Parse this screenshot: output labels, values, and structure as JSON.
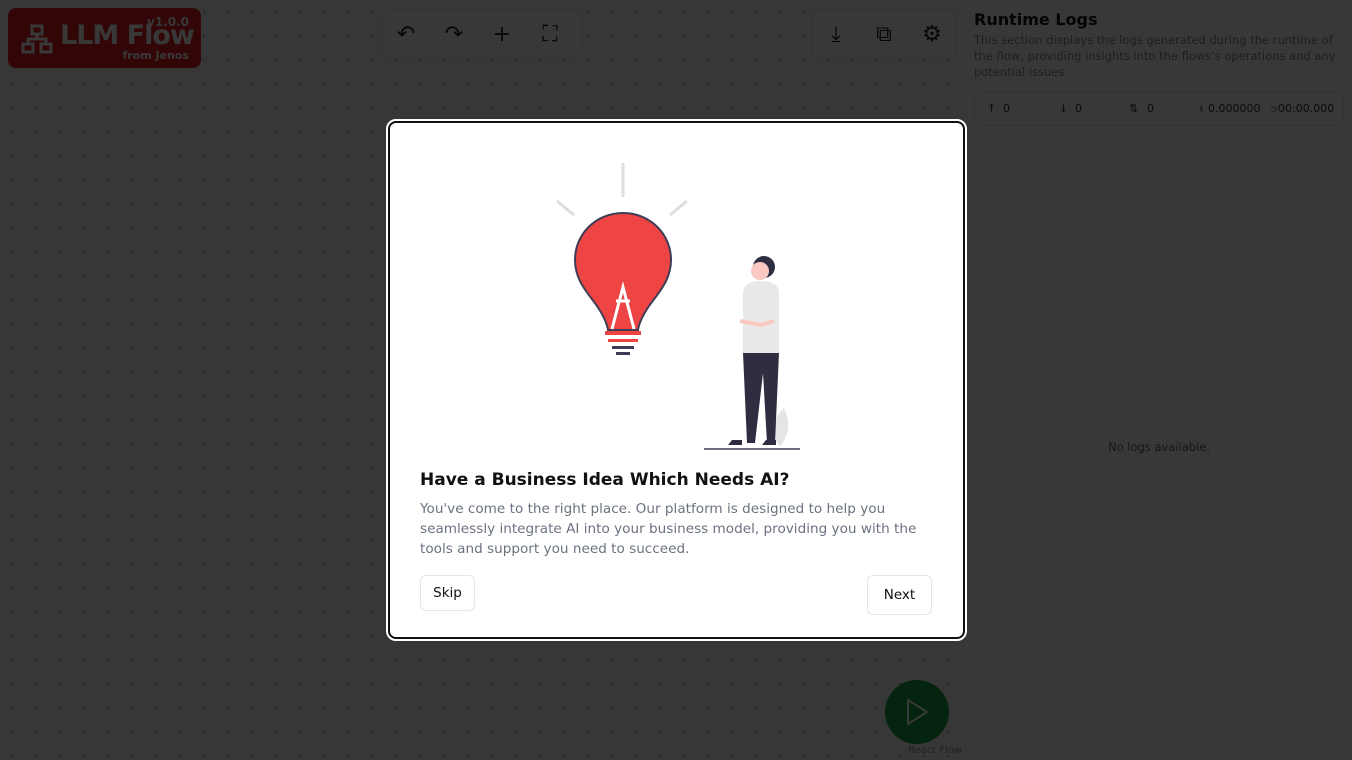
{
  "logo": {
    "title": "LLM Flow",
    "version": "v1.0.0",
    "subtitle": "from Jenos"
  },
  "toolbar": {
    "left": [
      {
        "icon": "undo-icon",
        "glyph": "↶"
      },
      {
        "icon": "redo-icon",
        "glyph": "↷"
      },
      {
        "icon": "plus-icon",
        "glyph": "+"
      },
      {
        "icon": "fullscreen-icon",
        "glyph": "⛶"
      }
    ],
    "right": [
      {
        "icon": "download-icon",
        "glyph": "⤓"
      },
      {
        "icon": "external-link-icon",
        "glyph": "⧉"
      },
      {
        "icon": "settings-icon",
        "glyph": "⚙"
      }
    ]
  },
  "logs": {
    "title": "Runtime Logs",
    "description": "This section displays the logs generated during the runtime of the flow, providing insights into the flows's operations and any potential issues.",
    "stats": {
      "up": "0",
      "down": "0",
      "total": "0",
      "cost": "0.000000",
      "time": "00:00.000"
    },
    "empty": "No logs available."
  },
  "canvas": {
    "attribution": "React Flow"
  },
  "modal": {
    "title": "Have a Business Idea Which Needs AI?",
    "body": "You've come to the right place. Our platform is designed to help you seamlessly integrate AI into your business model, providing you with the tools and support you need to succeed.",
    "skip": "Skip",
    "next": "Next"
  },
  "colors": {
    "brand": "#e11d1d",
    "run": "#16a34a",
    "bulb": "#ef4444"
  }
}
